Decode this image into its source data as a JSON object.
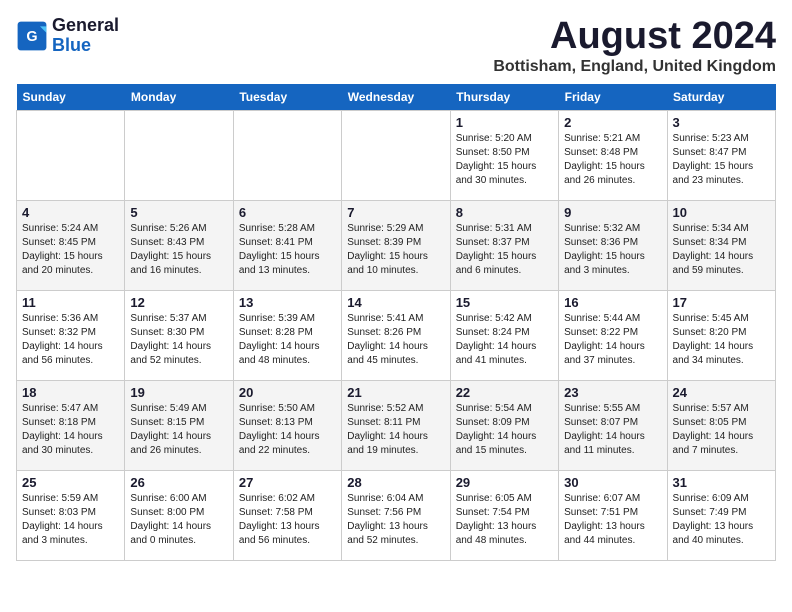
{
  "header": {
    "logo_line1": "General",
    "logo_line2": "Blue",
    "month_title": "August 2024",
    "location": "Bottisham, England, United Kingdom"
  },
  "weekdays": [
    "Sunday",
    "Monday",
    "Tuesday",
    "Wednesday",
    "Thursday",
    "Friday",
    "Saturday"
  ],
  "weeks": [
    [
      {
        "day": "",
        "info": ""
      },
      {
        "day": "",
        "info": ""
      },
      {
        "day": "",
        "info": ""
      },
      {
        "day": "",
        "info": ""
      },
      {
        "day": "1",
        "info": "Sunrise: 5:20 AM\nSunset: 8:50 PM\nDaylight: 15 hours\nand 30 minutes."
      },
      {
        "day": "2",
        "info": "Sunrise: 5:21 AM\nSunset: 8:48 PM\nDaylight: 15 hours\nand 26 minutes."
      },
      {
        "day": "3",
        "info": "Sunrise: 5:23 AM\nSunset: 8:47 PM\nDaylight: 15 hours\nand 23 minutes."
      }
    ],
    [
      {
        "day": "4",
        "info": "Sunrise: 5:24 AM\nSunset: 8:45 PM\nDaylight: 15 hours\nand 20 minutes."
      },
      {
        "day": "5",
        "info": "Sunrise: 5:26 AM\nSunset: 8:43 PM\nDaylight: 15 hours\nand 16 minutes."
      },
      {
        "day": "6",
        "info": "Sunrise: 5:28 AM\nSunset: 8:41 PM\nDaylight: 15 hours\nand 13 minutes."
      },
      {
        "day": "7",
        "info": "Sunrise: 5:29 AM\nSunset: 8:39 PM\nDaylight: 15 hours\nand 10 minutes."
      },
      {
        "day": "8",
        "info": "Sunrise: 5:31 AM\nSunset: 8:37 PM\nDaylight: 15 hours\nand 6 minutes."
      },
      {
        "day": "9",
        "info": "Sunrise: 5:32 AM\nSunset: 8:36 PM\nDaylight: 15 hours\nand 3 minutes."
      },
      {
        "day": "10",
        "info": "Sunrise: 5:34 AM\nSunset: 8:34 PM\nDaylight: 14 hours\nand 59 minutes."
      }
    ],
    [
      {
        "day": "11",
        "info": "Sunrise: 5:36 AM\nSunset: 8:32 PM\nDaylight: 14 hours\nand 56 minutes."
      },
      {
        "day": "12",
        "info": "Sunrise: 5:37 AM\nSunset: 8:30 PM\nDaylight: 14 hours\nand 52 minutes."
      },
      {
        "day": "13",
        "info": "Sunrise: 5:39 AM\nSunset: 8:28 PM\nDaylight: 14 hours\nand 48 minutes."
      },
      {
        "day": "14",
        "info": "Sunrise: 5:41 AM\nSunset: 8:26 PM\nDaylight: 14 hours\nand 45 minutes."
      },
      {
        "day": "15",
        "info": "Sunrise: 5:42 AM\nSunset: 8:24 PM\nDaylight: 14 hours\nand 41 minutes."
      },
      {
        "day": "16",
        "info": "Sunrise: 5:44 AM\nSunset: 8:22 PM\nDaylight: 14 hours\nand 37 minutes."
      },
      {
        "day": "17",
        "info": "Sunrise: 5:45 AM\nSunset: 8:20 PM\nDaylight: 14 hours\nand 34 minutes."
      }
    ],
    [
      {
        "day": "18",
        "info": "Sunrise: 5:47 AM\nSunset: 8:18 PM\nDaylight: 14 hours\nand 30 minutes."
      },
      {
        "day": "19",
        "info": "Sunrise: 5:49 AM\nSunset: 8:15 PM\nDaylight: 14 hours\nand 26 minutes."
      },
      {
        "day": "20",
        "info": "Sunrise: 5:50 AM\nSunset: 8:13 PM\nDaylight: 14 hours\nand 22 minutes."
      },
      {
        "day": "21",
        "info": "Sunrise: 5:52 AM\nSunset: 8:11 PM\nDaylight: 14 hours\nand 19 minutes."
      },
      {
        "day": "22",
        "info": "Sunrise: 5:54 AM\nSunset: 8:09 PM\nDaylight: 14 hours\nand 15 minutes."
      },
      {
        "day": "23",
        "info": "Sunrise: 5:55 AM\nSunset: 8:07 PM\nDaylight: 14 hours\nand 11 minutes."
      },
      {
        "day": "24",
        "info": "Sunrise: 5:57 AM\nSunset: 8:05 PM\nDaylight: 14 hours\nand 7 minutes."
      }
    ],
    [
      {
        "day": "25",
        "info": "Sunrise: 5:59 AM\nSunset: 8:03 PM\nDaylight: 14 hours\nand 3 minutes."
      },
      {
        "day": "26",
        "info": "Sunrise: 6:00 AM\nSunset: 8:00 PM\nDaylight: 14 hours\nand 0 minutes."
      },
      {
        "day": "27",
        "info": "Sunrise: 6:02 AM\nSunset: 7:58 PM\nDaylight: 13 hours\nand 56 minutes."
      },
      {
        "day": "28",
        "info": "Sunrise: 6:04 AM\nSunset: 7:56 PM\nDaylight: 13 hours\nand 52 minutes."
      },
      {
        "day": "29",
        "info": "Sunrise: 6:05 AM\nSunset: 7:54 PM\nDaylight: 13 hours\nand 48 minutes."
      },
      {
        "day": "30",
        "info": "Sunrise: 6:07 AM\nSunset: 7:51 PM\nDaylight: 13 hours\nand 44 minutes."
      },
      {
        "day": "31",
        "info": "Sunrise: 6:09 AM\nSunset: 7:49 PM\nDaylight: 13 hours\nand 40 minutes."
      }
    ]
  ]
}
